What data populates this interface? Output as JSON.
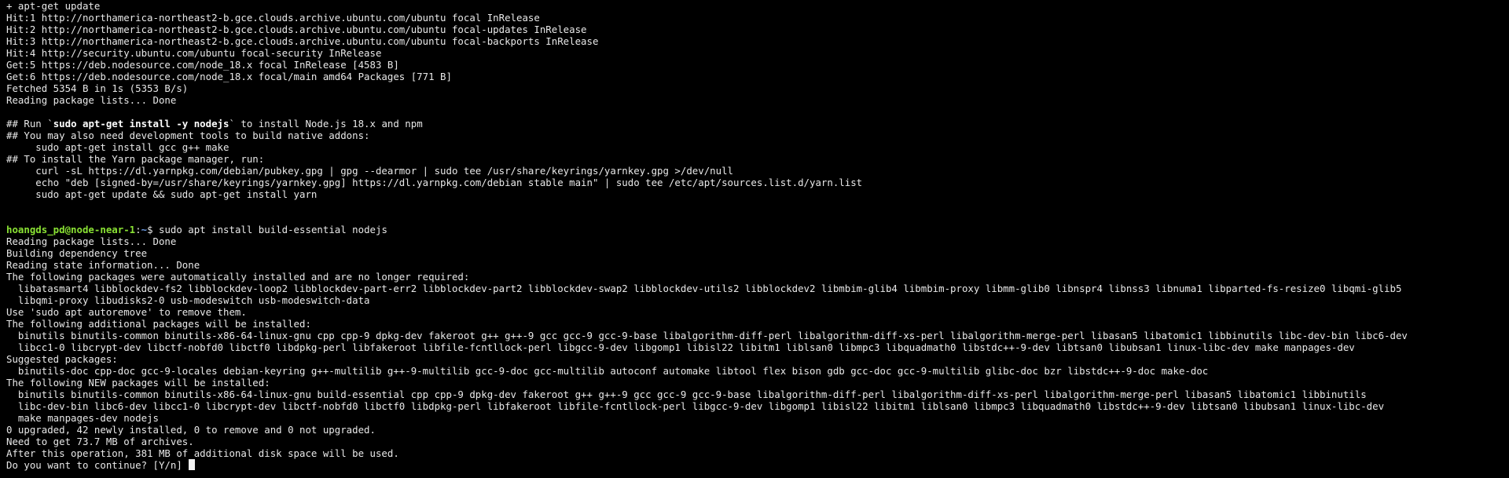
{
  "colors": {
    "background": "#000000",
    "text": "#e8e8e8",
    "prompt_user": "#8ae234",
    "prompt_path": "#6f9fe6",
    "cursor": "#f2f2f2"
  },
  "lines": [
    "+ apt-get update",
    "Hit:1 http://northamerica-northeast2-b.gce.clouds.archive.ubuntu.com/ubuntu focal InRelease",
    "Hit:2 http://northamerica-northeast2-b.gce.clouds.archive.ubuntu.com/ubuntu focal-updates InRelease",
    "Hit:3 http://northamerica-northeast2-b.gce.clouds.archive.ubuntu.com/ubuntu focal-backports InRelease",
    "Hit:4 http://security.ubuntu.com/ubuntu focal-security InRelease",
    "Get:5 https://deb.nodesource.com/node_18.x focal InRelease [4583 B]",
    "Get:6 https://deb.nodesource.com/node_18.x focal/main amd64 Packages [771 B]",
    "Fetched 5354 B in 1s (5353 B/s)",
    "Reading package lists... Done",
    "",
    "## Run `sudo apt-get install -y nodejs` to install Node.js 18.x and npm",
    "## You may also need development tools to build native addons:",
    "     sudo apt-get install gcc g++ make",
    "## To install the Yarn package manager, run:",
    "     curl -sL https://dl.yarnpkg.com/debian/pubkey.gpg | gpg --dearmor | sudo tee /usr/share/keyrings/yarnkey.gpg >/dev/null",
    "     echo \"deb [signed-by=/usr/share/keyrings/yarnkey.gpg] https://dl.yarnpkg.com/debian stable main\" | sudo tee /etc/apt/sources.list.d/yarn.list",
    "     sudo apt-get update && sudo apt-get install yarn",
    "",
    "",
    "hoangds_pd@node-near-1:~$ sudo apt install build-essential nodejs",
    "Reading package lists... Done",
    "Building dependency tree",
    "Reading state information... Done",
    "The following packages were automatically installed and are no longer required:",
    "  libatasmart4 libblockdev-fs2 libblockdev-loop2 libblockdev-part-err2 libblockdev-part2 libblockdev-swap2 libblockdev-utils2 libblockdev2 libmbim-glib4 libmbim-proxy libmm-glib0 libnspr4 libnss3 libnuma1 libparted-fs-resize0 libqmi-glib5",
    "  libqmi-proxy libudisks2-0 usb-modeswitch usb-modeswitch-data",
    "Use 'sudo apt autoremove' to remove them.",
    "The following additional packages will be installed:",
    "  binutils binutils-common binutils-x86-64-linux-gnu cpp cpp-9 dpkg-dev fakeroot g++ g++-9 gcc gcc-9 gcc-9-base libalgorithm-diff-perl libalgorithm-diff-xs-perl libalgorithm-merge-perl libasan5 libatomic1 libbinutils libc-dev-bin libc6-dev",
    "  libcc1-0 libcrypt-dev libctf-nobfd0 libctf0 libdpkg-perl libfakeroot libfile-fcntllock-perl libgcc-9-dev libgomp1 libisl22 libitm1 liblsan0 libmpc3 libquadmath0 libstdc++-9-dev libtsan0 libubsan1 linux-libc-dev make manpages-dev",
    "Suggested packages:",
    "  binutils-doc cpp-doc gcc-9-locales debian-keyring g++-multilib g++-9-multilib gcc-9-doc gcc-multilib autoconf automake libtool flex bison gdb gcc-doc gcc-9-multilib glibc-doc bzr libstdc++-9-doc make-doc",
    "The following NEW packages will be installed:",
    "  binutils binutils-common binutils-x86-64-linux-gnu build-essential cpp cpp-9 dpkg-dev fakeroot g++ g++-9 gcc gcc-9 gcc-9-base libalgorithm-diff-perl libalgorithm-diff-xs-perl libalgorithm-merge-perl libasan5 libatomic1 libbinutils",
    "  libc-dev-bin libc6-dev libcc1-0 libcrypt-dev libctf-nobfd0 libctf0 libdpkg-perl libfakeroot libfile-fcntllock-perl libgcc-9-dev libgomp1 libisl22 libitm1 liblsan0 libmpc3 libquadmath0 libstdc++-9-dev libtsan0 libubsan1 linux-libc-dev",
    "  make manpages-dev nodejs",
    "0 upgraded, 42 newly installed, 0 to remove and 0 not upgraded.",
    "Need to get 73.7 MB of archives.",
    "After this operation, 381 MB of additional disk space will be used.",
    "Do you want to continue? [Y/n] "
  ],
  "run_line": {
    "prefix": "## Run `",
    "bold": "sudo apt-get install -y nodejs",
    "suffix": "` to install Node.js 18.x and npm"
  },
  "prompt": {
    "user_host": "hoangds_pd@node-near-1",
    "colon": ":",
    "path": "~",
    "dollar": "$ ",
    "command": "sudo apt install build-essential nodejs"
  }
}
